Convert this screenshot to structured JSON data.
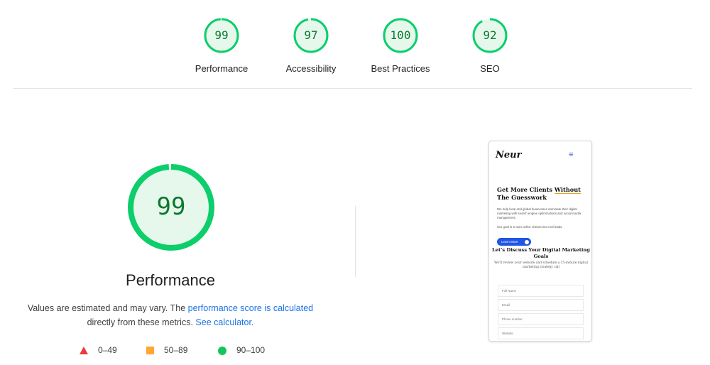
{
  "gauges": [
    {
      "score": "99",
      "label": "Performance",
      "value": 99,
      "color": "#0cce6b"
    },
    {
      "score": "97",
      "label": "Accessibility",
      "value": 97,
      "color": "#0cce6b"
    },
    {
      "score": "100",
      "label": "Best Practices",
      "value": 100,
      "color": "#0cce6b"
    },
    {
      "score": "92",
      "label": "SEO",
      "value": 92,
      "color": "#0cce6b"
    }
  ],
  "performance": {
    "score": "99",
    "value": 99,
    "title": "Performance",
    "desc_prefix": "Values are estimated and may vary. The ",
    "desc_link": "performance score is calculated",
    "desc_middle": "directly from these metrics.",
    "calc_link": "See calculator."
  },
  "legend": [
    {
      "range": "0–49",
      "shape": "triangle",
      "color": "#eb3b3b"
    },
    {
      "range": "50–89",
      "shape": "square",
      "color": "#ffa633"
    },
    {
      "range": "90–100",
      "shape": "circle",
      "color": "#16c55a"
    }
  ],
  "colors": {
    "pass_stroke": "#0cce6b",
    "pass_fill": "#e6f8ec",
    "pass_text": "#0a7a2f",
    "link": "#1a73e8"
  },
  "screenshot": {
    "logo": "Neur",
    "menu_icon": "hamburger-icon",
    "headline_part1": "Get More Clients ",
    "headline_underlined": "Without",
    "headline_part2": " The Guesswork",
    "para1": "We help local and global businesses dominate their digital marketing with search engine optimizations and social media management.",
    "para2": "Our goal is to turn online visitors into real leads.",
    "button": "Learn More",
    "subheading": "Let’s Discuss Your Digital Marketing Goals",
    "subtext": "We’ll review your website and schedule a 15-minute digital marketing strategy call",
    "fields": [
      "Full Name",
      "Email",
      "Phone number",
      "Website"
    ]
  }
}
